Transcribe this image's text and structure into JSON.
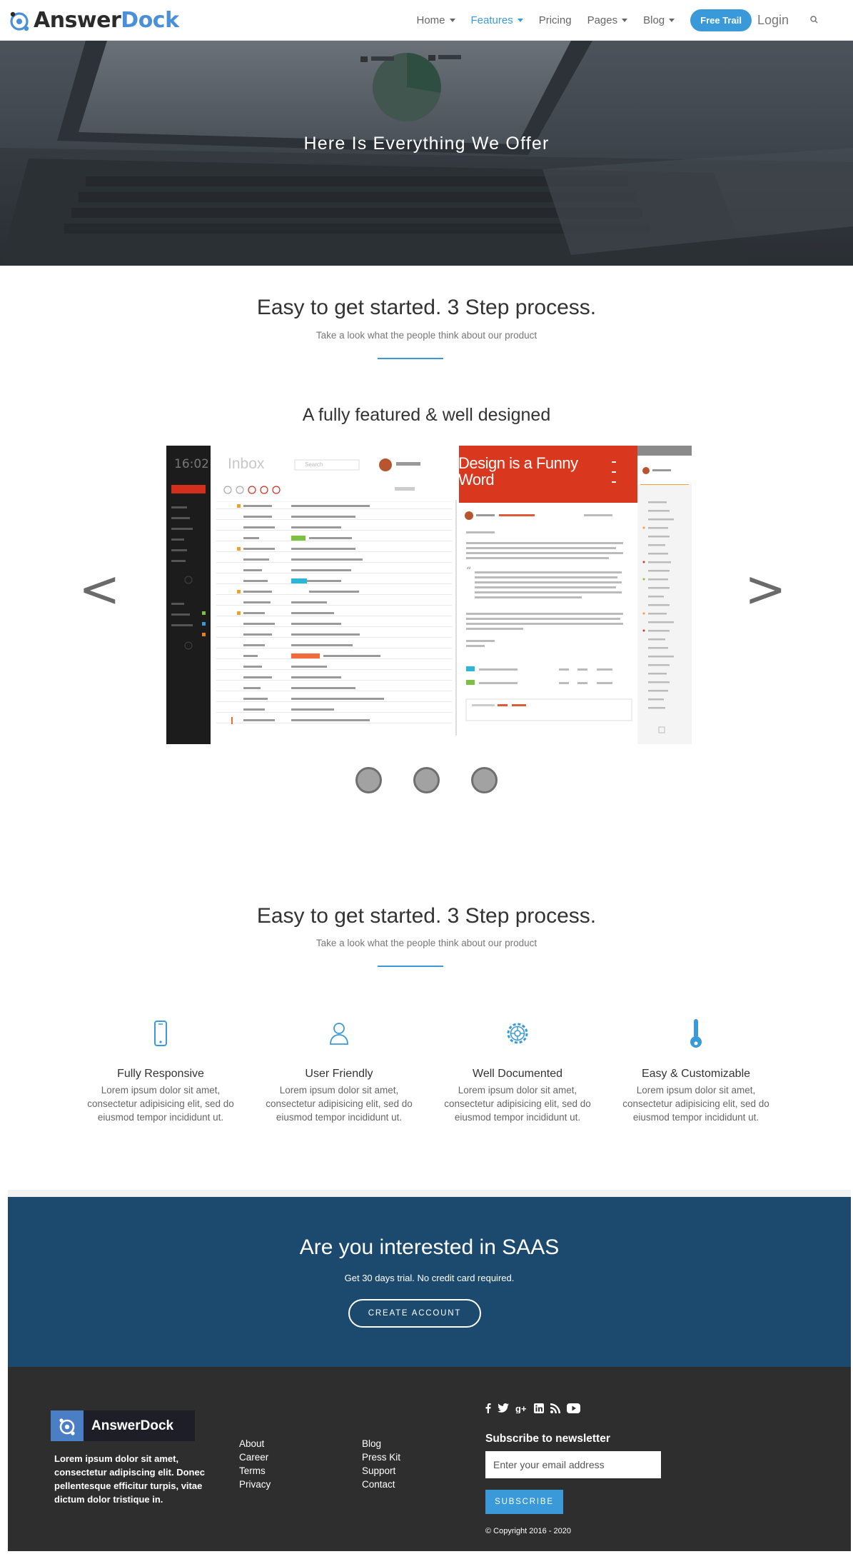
{
  "nav": {
    "brand_part1": "Answer",
    "brand_part2": "Dock",
    "items": [
      {
        "label": "Home"
      },
      {
        "label": "Features"
      },
      {
        "label": "Pricing"
      },
      {
        "label": "Pages"
      },
      {
        "label": "Blog"
      }
    ],
    "trial_label": "Free Trail",
    "login_label": "Login",
    "active_color": "#3a9ad9"
  },
  "hero": {
    "title": "Here Is Everything We Offer"
  },
  "section1": {
    "title": "Easy to get started. 3 Step process.",
    "subtitle": "Take a look what the people think about our product"
  },
  "showcase": {
    "heading": "A fully featured & well designed",
    "clock": "16:02",
    "inbox_label": "Inbox",
    "search_placeholder": "Search",
    "promo_title_line1": "Design is a Funny",
    "promo_title_line2": "Word",
    "prev_icon": "chevron-left",
    "next_icon": "chevron-right"
  },
  "section2": {
    "title": "Easy to get started. 3 Step process.",
    "subtitle": "Take a look what the people think about our product"
  },
  "features": [
    {
      "icon": "mobile-icon",
      "title": "Fully Responsive",
      "desc": "Lorem ipsum dolor sit amet, consectetur adipisicing elit, sed do eiusmod tempor incididunt ut."
    },
    {
      "icon": "user-icon",
      "title": "User Friendly",
      "desc": "Lorem ipsum dolor sit amet, consectetur adipisicing elit, sed do eiusmod tempor incididunt ut."
    },
    {
      "icon": "gear-icon",
      "title": "Well Documented",
      "desc": "Lorem ipsum dolor sit amet, consectetur adipisicing elit, sed do eiusmod tempor incididunt ut."
    },
    {
      "icon": "key-icon",
      "title": "Easy & Customizable",
      "desc": "Lorem ipsum dolor sit amet, consectetur adipisicing elit, sed do eiusmod tempor incididunt ut."
    }
  ],
  "cta": {
    "title": "Are you interested in SAAS",
    "subtitle": "Get 30 days trial. No credit card required.",
    "button": "CREATE ACCOUNT",
    "bg_color": "#1c4a6f"
  },
  "footer": {
    "brand": "AnswerDock",
    "about": "Lorem ipsum dolor sit amet, consectetur adipiscing elit. Donec pellentesque efficitur turpis, vitae dictum dolor tristique in.",
    "col1": [
      "About",
      "Career",
      "Terms",
      "Privacy"
    ],
    "col2": [
      "Blog",
      "Press Kit",
      "Support",
      "Contact"
    ],
    "social_icons": [
      "facebook-icon",
      "twitter-icon",
      "google-plus-icon",
      "linkedin-icon",
      "rss-icon",
      "youtube-icon"
    ],
    "newsletter_title": "Subscribe to newsletter",
    "email_placeholder": "Enter your email address",
    "subscribe_label": "SUBSCRIBE",
    "copyright": "© Copyright 2016 - 2020"
  }
}
